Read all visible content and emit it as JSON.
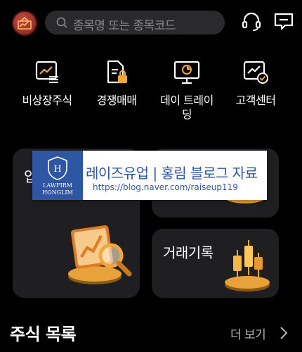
{
  "header": {
    "search_placeholder": "종목명 또는 종목코드"
  },
  "quick_menu": [
    {
      "label": "비상장주식",
      "icon": "chart-document-icon"
    },
    {
      "label": "경쟁매매",
      "icon": "document-lock-icon"
    },
    {
      "label": "데이 트레이\n딩",
      "icon": "monitor-pie-icon"
    },
    {
      "label": "고객센터",
      "icon": "chart-check-icon"
    }
  ],
  "cards": {
    "left_title": "입",
    "bottom_right_title": "거래기록"
  },
  "banner": {
    "badge_text": "LAWFIRM\nHONGLIM",
    "title": "레이즈유업 | 홍림 블로그 자료",
    "url": "https://blog.naver.com/raiseup119"
  },
  "stock_list": {
    "title": "주식 목록",
    "more_label": "더 보기"
  },
  "colors": {
    "background": "#000000",
    "card": "#1f1f21",
    "search_bg": "#2a2a2c",
    "banner_blue": "#2f56a3",
    "gold": "#f0a83a"
  }
}
